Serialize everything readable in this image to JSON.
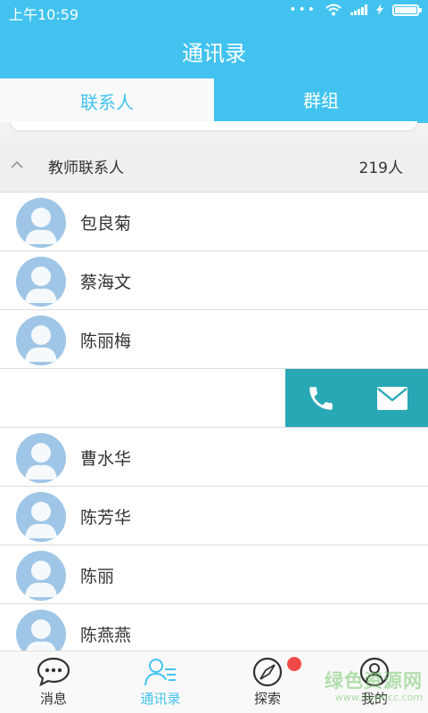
{
  "status": {
    "time": "上午10:59",
    "dots": "•••"
  },
  "header": {
    "title": "通讯录"
  },
  "tabs": [
    {
      "label": "联系人",
      "active": true
    },
    {
      "label": "群组",
      "active": false
    }
  ],
  "group": {
    "name": "教师联系人",
    "count": "219人",
    "expanded": true
  },
  "contacts": [
    {
      "name": "包良菊"
    },
    {
      "name": "蔡海文"
    },
    {
      "name": "陈丽梅"
    },
    {
      "name": "",
      "swiped": true
    },
    {
      "name": "曹水华"
    },
    {
      "name": "陈芳华"
    },
    {
      "name": "陈丽"
    },
    {
      "name": "陈燕燕"
    }
  ],
  "swipe_actions": {
    "icons": [
      "phone-icon",
      "mail-icon"
    ]
  },
  "nav": [
    {
      "label": "消息",
      "icon": "chat-bubble-icon",
      "active": false
    },
    {
      "label": "通讯录",
      "icon": "contacts-icon",
      "active": true
    },
    {
      "label": "探索",
      "icon": "compass-icon",
      "active": false,
      "badge": true
    },
    {
      "label": "我的",
      "icon": "profile-icon",
      "active": false
    }
  ],
  "watermark": {
    "main": "绿色资源网",
    "sub": "www.downcc.com"
  },
  "colors": {
    "primary": "#42c3ef",
    "action": "#28a7b5",
    "badge": "#f04a47",
    "avatar": "#9fc6e6"
  }
}
